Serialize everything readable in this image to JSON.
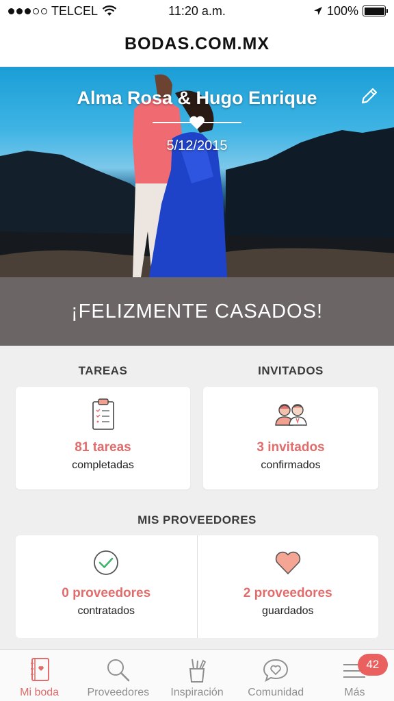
{
  "status_bar": {
    "carrier": "TELCEL",
    "time": "11:20 a.m.",
    "battery": "100%"
  },
  "header": {
    "title": "BODAS.COM.MX"
  },
  "hero": {
    "names": "Alma Rosa & Hugo Enrique",
    "date": "5/12/2015"
  },
  "banner": {
    "text": "¡FELIZMENTE CASADOS!"
  },
  "tasks": {
    "heading": "TAREAS",
    "count": "81 tareas",
    "label": "completadas"
  },
  "guests": {
    "heading": "INVITADOS",
    "count": "3 invitados",
    "label": "confirmados"
  },
  "providers": {
    "heading": "MIS PROVEEDORES",
    "hired": {
      "count": "0 proveedores",
      "label": "contratados"
    },
    "saved": {
      "count": "2 proveedores",
      "label": "guardados"
    }
  },
  "tab_bar": {
    "items": [
      {
        "label": "Mi boda",
        "icon": "notebook-icon",
        "active": true
      },
      {
        "label": "Proveedores",
        "icon": "search-icon"
      },
      {
        "label": "Inspiración",
        "icon": "pencil-cup-icon"
      },
      {
        "label": "Comunidad",
        "icon": "chat-heart-icon"
      },
      {
        "label": "Más",
        "icon": "menu-icon",
        "badge": "42"
      }
    ]
  },
  "colors": {
    "accent": "#e06d6b",
    "banner": "#6b6566",
    "background": "#f0eff0"
  }
}
